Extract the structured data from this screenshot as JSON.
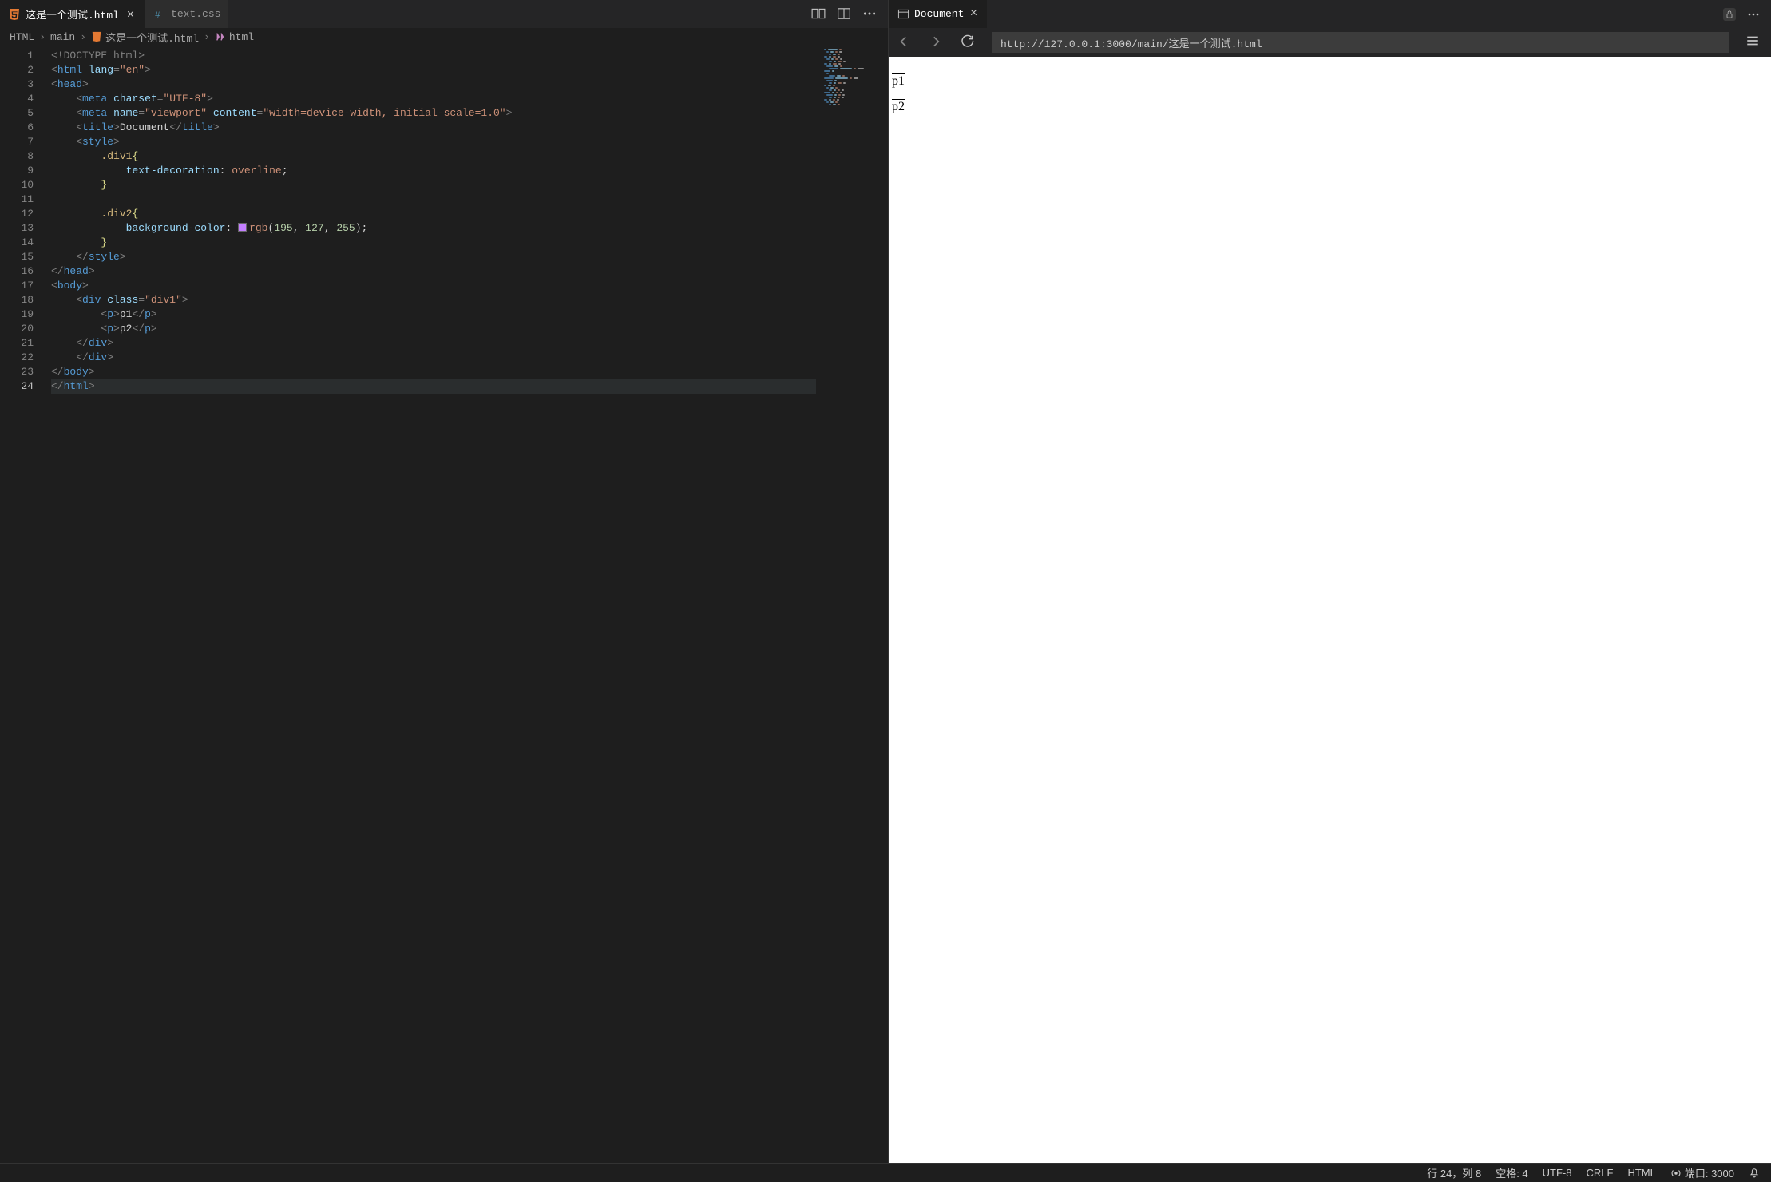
{
  "tabs": [
    {
      "label": "这是一个测试.html",
      "active": true,
      "closable": true,
      "icon": "html"
    },
    {
      "label": "text.css",
      "active": false,
      "closable": false,
      "icon": "css"
    }
  ],
  "breadcrumbs": {
    "items": [
      "HTML",
      "main",
      "这是一个测试.html",
      "html"
    ],
    "iconLast": "tag"
  },
  "editor": {
    "currentLine": 24,
    "lines": [
      [
        [
          "<!",
          "doctype"
        ],
        [
          "DOCTYPE html",
          "doctype"
        ],
        [
          ">",
          "doctype"
        ]
      ],
      [
        [
          "<",
          "punc"
        ],
        [
          "html",
          "tag"
        ],
        [
          " ",
          "text"
        ],
        [
          "lang",
          "attr"
        ],
        [
          "=",
          "punc"
        ],
        [
          "\"en\"",
          "str"
        ],
        [
          ">",
          "punc"
        ]
      ],
      [
        [
          "<",
          "punc"
        ],
        [
          "head",
          "tag"
        ],
        [
          ">",
          "punc"
        ]
      ],
      [
        [
          "    ",
          "text"
        ],
        [
          "<",
          "punc"
        ],
        [
          "meta",
          "tag"
        ],
        [
          " ",
          "text"
        ],
        [
          "charset",
          "attr"
        ],
        [
          "=",
          "punc"
        ],
        [
          "\"UTF-8\"",
          "str"
        ],
        [
          ">",
          "punc"
        ]
      ],
      [
        [
          "    ",
          "text"
        ],
        [
          "<",
          "punc"
        ],
        [
          "meta",
          "tag"
        ],
        [
          " ",
          "text"
        ],
        [
          "name",
          "attr"
        ],
        [
          "=",
          "punc"
        ],
        [
          "\"viewport\"",
          "str"
        ],
        [
          " ",
          "text"
        ],
        [
          "content",
          "attr"
        ],
        [
          "=",
          "punc"
        ],
        [
          "\"width=device-width, initial-scale=1.0\"",
          "str"
        ],
        [
          ">",
          "punc"
        ]
      ],
      [
        [
          "    ",
          "text"
        ],
        [
          "<",
          "punc"
        ],
        [
          "title",
          "tag"
        ],
        [
          ">",
          "punc"
        ],
        [
          "Document",
          "text"
        ],
        [
          "</",
          "punc"
        ],
        [
          "title",
          "tag"
        ],
        [
          ">",
          "punc"
        ]
      ],
      [
        [
          "    ",
          "text"
        ],
        [
          "<",
          "punc"
        ],
        [
          "style",
          "tag"
        ],
        [
          ">",
          "punc"
        ]
      ],
      [
        [
          "        ",
          "text"
        ],
        [
          ".div1",
          "sel"
        ],
        [
          "{",
          "brace"
        ]
      ],
      [
        [
          "            ",
          "text"
        ],
        [
          "text-decoration",
          "prop"
        ],
        [
          ": ",
          "text"
        ],
        [
          "overline",
          "val"
        ],
        [
          ";",
          "text"
        ]
      ],
      [
        [
          "        ",
          "text"
        ],
        [
          "}",
          "brace"
        ]
      ],
      [
        [
          " ",
          "text"
        ]
      ],
      [
        [
          "        ",
          "text"
        ],
        [
          ".div2",
          "sel"
        ],
        [
          "{",
          "brace"
        ]
      ],
      [
        [
          "            ",
          "text"
        ],
        [
          "background-color",
          "prop"
        ],
        [
          ": ",
          "text"
        ],
        [
          "SWATCH",
          "swatch"
        ],
        [
          "rgb",
          "func"
        ],
        [
          "(",
          "text"
        ],
        [
          "195",
          "num"
        ],
        [
          ", ",
          "text"
        ],
        [
          "127",
          "num"
        ],
        [
          ", ",
          "text"
        ],
        [
          "255",
          "num"
        ],
        [
          ")",
          "text"
        ],
        [
          ";",
          "text"
        ]
      ],
      [
        [
          "        ",
          "text"
        ],
        [
          "}",
          "brace"
        ]
      ],
      [
        [
          "    ",
          "text"
        ],
        [
          "</",
          "punc"
        ],
        [
          "style",
          "tag"
        ],
        [
          ">",
          "punc"
        ]
      ],
      [
        [
          "</",
          "punc"
        ],
        [
          "head",
          "tag"
        ],
        [
          ">",
          "punc"
        ]
      ],
      [
        [
          "<",
          "punc"
        ],
        [
          "body",
          "tag"
        ],
        [
          ">",
          "punc"
        ]
      ],
      [
        [
          "    ",
          "text"
        ],
        [
          "<",
          "punc"
        ],
        [
          "div",
          "tag"
        ],
        [
          " ",
          "text"
        ],
        [
          "class",
          "attr"
        ],
        [
          "=",
          "punc"
        ],
        [
          "\"div1\"",
          "str"
        ],
        [
          ">",
          "punc"
        ]
      ],
      [
        [
          "        ",
          "text"
        ],
        [
          "<",
          "punc"
        ],
        [
          "p",
          "tag"
        ],
        [
          ">",
          "punc"
        ],
        [
          "p1",
          "text"
        ],
        [
          "</",
          "punc"
        ],
        [
          "p",
          "tag"
        ],
        [
          ">",
          "punc"
        ]
      ],
      [
        [
          "        ",
          "text"
        ],
        [
          "<",
          "punc"
        ],
        [
          "p",
          "tag"
        ],
        [
          ">",
          "punc"
        ],
        [
          "p2",
          "text"
        ],
        [
          "</",
          "punc"
        ],
        [
          "p",
          "tag"
        ],
        [
          ">",
          "punc"
        ]
      ],
      [
        [
          "    ",
          "text"
        ],
        [
          "</",
          "punc"
        ],
        [
          "div",
          "tag"
        ],
        [
          ">",
          "punc"
        ]
      ],
      [
        [
          "    ",
          "text"
        ],
        [
          "</",
          "punc"
        ],
        [
          "div",
          "tag"
        ],
        [
          ">",
          "punc"
        ]
      ],
      [
        [
          "</",
          "punc"
        ],
        [
          "body",
          "tag"
        ],
        [
          ">",
          "punc"
        ]
      ],
      [
        [
          "</",
          "punc"
        ],
        [
          "html",
          "tag"
        ],
        [
          ">",
          "punc"
        ]
      ]
    ]
  },
  "preview": {
    "title": "Document",
    "url": "http://127.0.0.1:3000/main/这是一个测试.html",
    "p1": "p1",
    "p2": "p2"
  },
  "status": {
    "cursor": "行 24，列 8",
    "spaces": "空格: 4",
    "encoding": "UTF-8",
    "eol": "CRLF",
    "language": "HTML",
    "port": "端口: 3000"
  }
}
